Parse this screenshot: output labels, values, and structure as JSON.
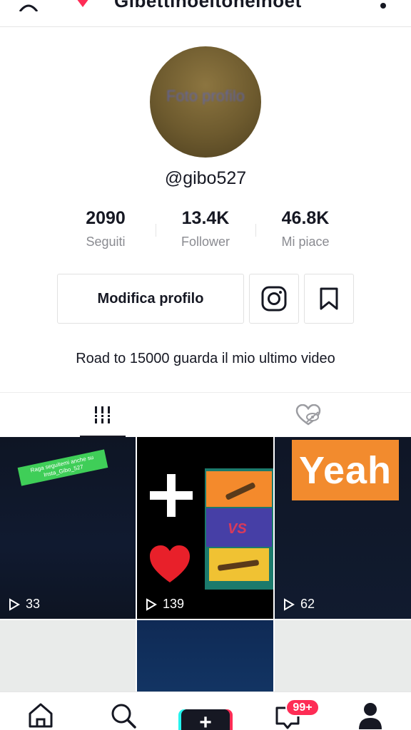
{
  "header": {
    "username_title": "Gibettinoeltoneinoet",
    "icons": [
      "add-user-icon",
      "heart-icon",
      "more-icon"
    ]
  },
  "profile": {
    "avatar_text": "Foto profilo",
    "handle": "@gibo527",
    "bio": "Road to 15000 guarda il mio ultimo video"
  },
  "stats": [
    {
      "value": "2090",
      "label": "Seguiti"
    },
    {
      "value": "13.4K",
      "label": "Follower"
    },
    {
      "value": "46.8K",
      "label": "Mi piace"
    }
  ],
  "actions": {
    "edit_profile": "Modifica profilo",
    "icons": [
      "instagram-icon",
      "bookmark-icon"
    ]
  },
  "tabs": {
    "icons": [
      "grid-icon",
      "liked-hidden-icon"
    ],
    "active": "grid"
  },
  "videos": [
    {
      "views": "33",
      "overlay_text": "Raga seguitemi anche su Insta_Gibo_527"
    },
    {
      "views": "139",
      "overlay_text": "VS"
    },
    {
      "views": "62",
      "overlay_text": "Yeah"
    },
    {
      "views": ""
    },
    {
      "views": ""
    },
    {
      "views": ""
    }
  ],
  "navbar": {
    "icons": [
      "home-icon",
      "search-icon",
      "create-icon",
      "inbox-icon",
      "profile-icon"
    ],
    "plus_label": "+",
    "inbox_badge": "99+"
  },
  "colors": {
    "accent_red": "#fe2c55",
    "accent_cyan": "#25f4ee",
    "text": "#161823",
    "muted": "#8a8b91"
  }
}
